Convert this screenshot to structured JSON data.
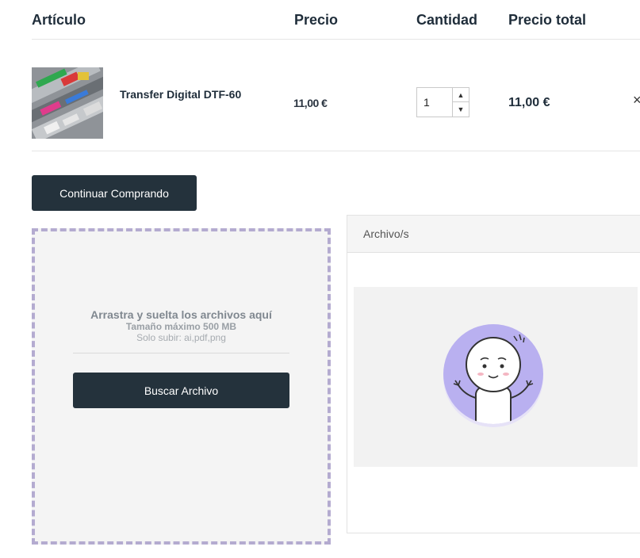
{
  "table": {
    "headers": {
      "article": "Artículo",
      "price": "Precio",
      "quantity": "Cantidad",
      "total": "Precio total"
    }
  },
  "product": {
    "name": "Transfer Digital DTF-60",
    "price": "11,00 €",
    "quantity": "1",
    "total": "11,00 €",
    "remove_symbol": "×"
  },
  "actions": {
    "continue_label": "Continuar Comprando"
  },
  "upload": {
    "title": "Arrastra y suelta los archivos aquí",
    "max_size": "Tamaño máximo 500 MB",
    "allowed": "Solo subir: ai,pdf,png",
    "browse_label": "Buscar Archivo"
  },
  "files_panel": {
    "title": "Archivo/s"
  },
  "colors": {
    "primary_button": "#24323c",
    "dashed_border": "#b4abd0",
    "illustration_circle": "#b9b0f0"
  },
  "icons": {
    "spin_up": "chevron-up-icon",
    "spin_down": "chevron-down-icon",
    "remove": "close-icon",
    "empty_state": "shrug-character-illustration"
  }
}
